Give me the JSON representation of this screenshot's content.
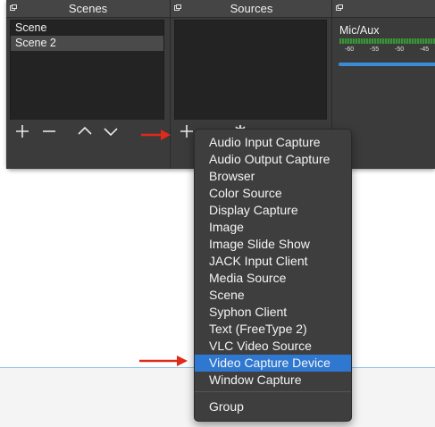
{
  "scenes_dock": {
    "title": "Scenes",
    "items": [
      {
        "label": "Scene",
        "selected": false
      },
      {
        "label": "Scene 2",
        "selected": true
      }
    ],
    "toolbar": {
      "add_icon": "plus-icon",
      "remove_icon": "minus-icon",
      "up_icon": "chevron-up-icon",
      "down_icon": "chevron-down-icon"
    }
  },
  "sources_dock": {
    "title": "Sources",
    "items": [],
    "toolbar": {
      "add_icon": "plus-icon",
      "settings_icon": "gear-icon"
    }
  },
  "mixer_dock": {
    "channel_label": "Mic/Aux",
    "meter_ticks": [
      "-60",
      "-55",
      "-50",
      "-45"
    ]
  },
  "source_menu": {
    "items": [
      {
        "label": "Audio Input Capture",
        "highlighted": false
      },
      {
        "label": "Audio Output Capture",
        "highlighted": false
      },
      {
        "label": "Browser",
        "highlighted": false
      },
      {
        "label": "Color Source",
        "highlighted": false
      },
      {
        "label": "Display Capture",
        "highlighted": false
      },
      {
        "label": "Image",
        "highlighted": false
      },
      {
        "label": "Image Slide Show",
        "highlighted": false
      },
      {
        "label": "JACK Input Client",
        "highlighted": false
      },
      {
        "label": "Media Source",
        "highlighted": false
      },
      {
        "label": "Scene",
        "highlighted": false
      },
      {
        "label": "Syphon Client",
        "highlighted": false
      },
      {
        "label": "Text (FreeType 2)",
        "highlighted": false
      },
      {
        "label": "VLC Video Source",
        "highlighted": false
      },
      {
        "label": "Video Capture Device",
        "highlighted": true
      },
      {
        "label": "Window Capture",
        "highlighted": false
      }
    ],
    "group_label": "Group"
  },
  "colors": {
    "accent": "#2f78d1",
    "annotation_arrow": "#e02a1b",
    "panel_bg": "#3b3b3b",
    "list_bg": "#232323"
  }
}
